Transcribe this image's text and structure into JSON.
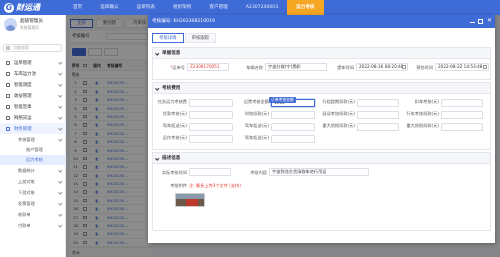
{
  "brand": {
    "name": "财运通"
  },
  "topnav": [
    {
      "label": "首页",
      "active": false
    },
    {
      "label": "运单确认",
      "active": false
    },
    {
      "label": "运单列表",
      "active": false
    },
    {
      "label": "组织架构",
      "active": false
    },
    {
      "label": "客户管理",
      "active": false
    },
    {
      "label": "A2307240003",
      "active": false
    },
    {
      "label": "运力考核",
      "active": true
    }
  ],
  "user": {
    "name": "超级管理员",
    "role": "系统管理员"
  },
  "sidebar": {
    "search_placeholder": "功能搜索",
    "menu": [
      {
        "label": "运单管理",
        "icon": "document-icon"
      },
      {
        "label": "车库运力池",
        "icon": "truck-icon"
      },
      {
        "label": "智能调度",
        "icon": "dispatch-icon"
      },
      {
        "label": "收益管理",
        "icon": "wallet-icon"
      },
      {
        "label": "智能签章",
        "icon": "stamp-icon"
      },
      {
        "label": "网络货运",
        "icon": "network-icon"
      },
      {
        "label": "财务管理",
        "icon": "finance-icon"
      }
    ],
    "submenu": [
      {
        "label": "考核管理",
        "level": 1
      },
      {
        "label": "账户管理",
        "level": 2
      },
      {
        "label": "运力考核",
        "level": 2,
        "active": true
      },
      {
        "label": "数据统计",
        "level": 1
      },
      {
        "label": "上游对账",
        "level": 1
      },
      {
        "label": "下游对账",
        "level": 1
      },
      {
        "label": "发票管理",
        "level": 1
      },
      {
        "label": "收款单",
        "level": 1
      },
      {
        "label": "付款单",
        "level": 1
      }
    ]
  },
  "page_tabs": [
    "全部",
    "我创建",
    "待审核"
  ],
  "filter": {
    "label": "考核编号"
  },
  "grid": {
    "headers": [
      "序号",
      "",
      "操作",
      "考核编号"
    ],
    "rows": [
      {
        "no": "1",
        "code": "KH20230..."
      },
      {
        "no": "2",
        "code": "KH20230..."
      },
      {
        "no": "3",
        "code": "KH20230..."
      },
      {
        "no": "4",
        "code": "KH20230..."
      },
      {
        "no": "5",
        "code": "KH20230..."
      },
      {
        "no": "6",
        "code": "KH20230..."
      },
      {
        "no": "7",
        "code": "KH20230..."
      },
      {
        "no": "8",
        "code": "KH20230..."
      },
      {
        "no": "9",
        "code": "KH20230..."
      },
      {
        "no": "10",
        "code": "KH20230..."
      },
      {
        "no": "11",
        "code": "KH20230..."
      },
      {
        "no": "12",
        "code": "KH20230..."
      },
      {
        "no": "13",
        "code": "KH20230..."
      },
      {
        "no": "14",
        "code": "KH20230..."
      },
      {
        "no": "15",
        "code": "KH20230..."
      },
      {
        "no": "16",
        "code": "KH20230..."
      },
      {
        "no": "17",
        "code": "KH20230..."
      },
      {
        "no": "18",
        "code": "KH20230..."
      },
      {
        "no": "19",
        "code": "KH20230..."
      },
      {
        "no": "20",
        "code": "KH20230..."
      },
      {
        "no": "21",
        "code": "KH20230..."
      }
    ],
    "filter_row_label": "筛选",
    "footer": "合计"
  },
  "modal": {
    "title": "考核编号: KH202308210019",
    "tabs": [
      "考核详情",
      "审核跟踪"
    ],
    "basic": {
      "title": "单据信息",
      "fields": {
        "code_label": "运单号",
        "code_value": "Z2308170051",
        "vehicle_label": "车辆名称",
        "vehicle_value": "宁波分拨(宁)黑职",
        "start_label": "提车时间",
        "start_value": "2022-08-16 08:20:48",
        "end_label": "预估时间",
        "end_value": "2022-08-22 14:53:48"
      }
    },
    "fees": {
      "title": "考核费用",
      "tooltip": "订单考核金额",
      "rows": [
        [
          "任务运力考核费",
          "",
          "运费考核金额",
          "1000",
          "行程超期扣款(元)",
          "",
          "扣车考核(元)",
          ""
        ],
        [
          "货款考核(元)",
          "",
          "时效扣款(元)",
          "",
          "延误考核扣款(元)",
          "",
          "行车考核扣款(元)",
          ""
        ],
        [
          "驾车拒送(元)",
          "",
          "驾车拒送(元)",
          "",
          "重大质损扣款(元)",
          "",
          "重大质损扣款(元)",
          ""
        ],
        [
          "运作考核(元)",
          "",
          "驾车拒送(元)",
          "",
          "",
          "",
          "",
          ""
        ]
      ]
    },
    "remark": {
      "title": "描述信息",
      "actual_label": "实际考核时间",
      "actual_value": "",
      "content_label": "考核内容",
      "content_value": "宁波到北仑货场取车进行吊运",
      "attach_label": "考核附件",
      "attach_hint": "注: 最多上传3个文件 (支持)"
    }
  }
}
